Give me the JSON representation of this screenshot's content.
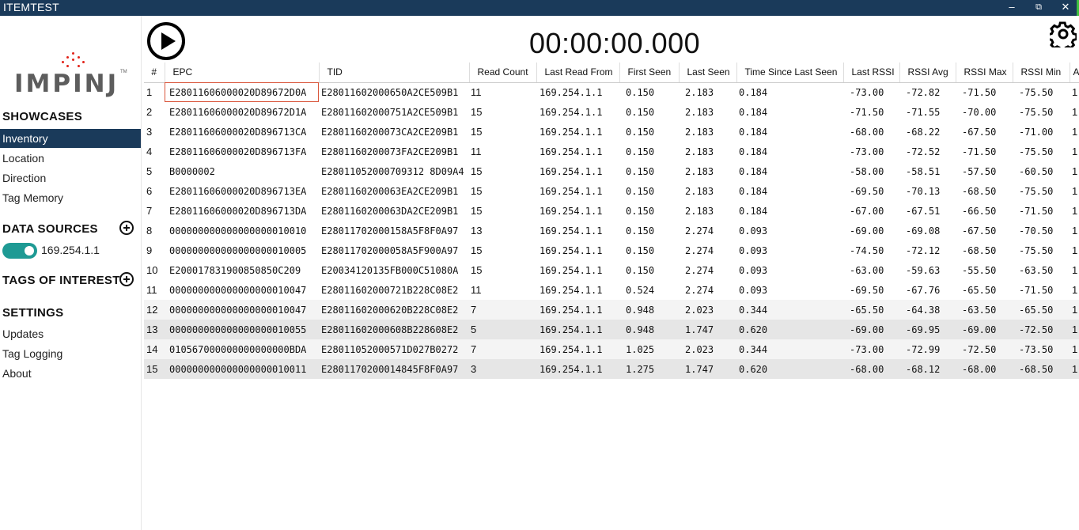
{
  "window": {
    "title": "ITEMTEST",
    "minimize": "–",
    "restore": "⧉",
    "close": "✕"
  },
  "sidebar": {
    "logo_text": "IMPINJ",
    "logo_tm": "TM",
    "showcases_title": "SHOWCASES",
    "showcases": [
      {
        "label": "Inventory",
        "active": true
      },
      {
        "label": "Location",
        "active": false
      },
      {
        "label": "Direction",
        "active": false
      },
      {
        "label": "Tag Memory",
        "active": false
      }
    ],
    "data_sources_title": "DATA SOURCES",
    "data_source": {
      "label": "169.254.1.1",
      "enabled": true
    },
    "tags_of_interest_title": "TAGS OF INTEREST",
    "settings_title": "SETTINGS",
    "settings": [
      {
        "label": "Updates"
      },
      {
        "label": "Tag Logging"
      },
      {
        "label": "About"
      }
    ]
  },
  "toolbar": {
    "timer": "00:00:00.000",
    "play_icon": "play-icon",
    "settings_icon": "gear-icon"
  },
  "table": {
    "columns": [
      "#",
      "EPC",
      "TID",
      "Read Count",
      "Last Read From",
      "First Seen",
      "Last Seen",
      "Time Since Last Seen",
      "Last RSSI",
      "RSSI Avg",
      "RSSI Max",
      "RSSI Min",
      "A"
    ],
    "rows": [
      {
        "n": "1",
        "epc": "E28011606000020D89672D0A",
        "tid": "E28011602000650A2CE509B1",
        "rc": "11",
        "from": "169.254.1.1",
        "first": "0.150",
        "last": "2.183",
        "since": "0.184",
        "lrssi": "-73.00",
        "avg": "-72.82",
        "max": "-71.50",
        "min": "-75.50",
        "extra": "1"
      },
      {
        "n": "2",
        "epc": "E28011606000020D89672D1A",
        "tid": "E28011602000751A2CE509B1",
        "rc": "15",
        "from": "169.254.1.1",
        "first": "0.150",
        "last": "2.183",
        "since": "0.184",
        "lrssi": "-71.50",
        "avg": "-71.55",
        "max": "-70.00",
        "min": "-75.50",
        "extra": "1"
      },
      {
        "n": "3",
        "epc": "E28011606000020D896713CA",
        "tid": "E2801160200073CA2CE209B1",
        "rc": "15",
        "from": "169.254.1.1",
        "first": "0.150",
        "last": "2.183",
        "since": "0.184",
        "lrssi": "-68.00",
        "avg": "-68.22",
        "max": "-67.50",
        "min": "-71.00",
        "extra": "1"
      },
      {
        "n": "4",
        "epc": "E28011606000020D896713FA",
        "tid": "E2801160200073FA2CE209B1",
        "rc": "11",
        "from": "169.254.1.1",
        "first": "0.150",
        "last": "2.183",
        "since": "0.184",
        "lrssi": "-73.00",
        "avg": "-72.52",
        "max": "-71.50",
        "min": "-75.50",
        "extra": "1"
      },
      {
        "n": "5",
        "epc": "B0000002",
        "tid": "E28011052000709312 8D09A4",
        "rc": "15",
        "from": "169.254.1.1",
        "first": "0.150",
        "last": "2.183",
        "since": "0.184",
        "lrssi": "-58.00",
        "avg": "-58.51",
        "max": "-57.50",
        "min": "-60.50",
        "extra": "1"
      },
      {
        "n": "6",
        "epc": "E28011606000020D896713EA",
        "tid": "E2801160200063EA2CE209B1",
        "rc": "15",
        "from": "169.254.1.1",
        "first": "0.150",
        "last": "2.183",
        "since": "0.184",
        "lrssi": "-69.50",
        "avg": "-70.13",
        "max": "-68.50",
        "min": "-75.50",
        "extra": "1"
      },
      {
        "n": "7",
        "epc": "E28011606000020D896713DA",
        "tid": "E2801160200063DA2CE209B1",
        "rc": "15",
        "from": "169.254.1.1",
        "first": "0.150",
        "last": "2.183",
        "since": "0.184",
        "lrssi": "-67.00",
        "avg": "-67.51",
        "max": "-66.50",
        "min": "-71.50",
        "extra": "1"
      },
      {
        "n": "8",
        "epc": "000000000000000000010010",
        "tid": "E28011702000158A5F8F0A97",
        "rc": "13",
        "from": "169.254.1.1",
        "first": "0.150",
        "last": "2.274",
        "since": "0.093",
        "lrssi": "-69.00",
        "avg": "-69.08",
        "max": "-67.50",
        "min": "-70.50",
        "extra": "1"
      },
      {
        "n": "9",
        "epc": "000000000000000000010005",
        "tid": "E28011702000058A5F900A97",
        "rc": "15",
        "from": "169.254.1.1",
        "first": "0.150",
        "last": "2.274",
        "since": "0.093",
        "lrssi": "-74.50",
        "avg": "-72.12",
        "max": "-68.50",
        "min": "-75.50",
        "extra": "1"
      },
      {
        "n": "10",
        "epc": "E200017831900850850C209",
        "tid": "E20034120135FB000C51080A",
        "rc": "15",
        "from": "169.254.1.1",
        "first": "0.150",
        "last": "2.274",
        "since": "0.093",
        "lrssi": "-63.00",
        "avg": "-59.63",
        "max": "-55.50",
        "min": "-63.50",
        "extra": "1"
      },
      {
        "n": "11",
        "epc": "000000000000000000010047",
        "tid": "E28011602000721B228C08E2",
        "rc": "11",
        "from": "169.254.1.1",
        "first": "0.524",
        "last": "2.274",
        "since": "0.093",
        "lrssi": "-69.50",
        "avg": "-67.76",
        "max": "-65.50",
        "min": "-71.50",
        "extra": "1"
      },
      {
        "n": "12",
        "epc": "000000000000000000010047",
        "tid": "E28011602000620B228C08E2",
        "rc": "7",
        "from": "169.254.1.1",
        "first": "0.948",
        "last": "2.023",
        "since": "0.344",
        "lrssi": "-65.50",
        "avg": "-64.38",
        "max": "-63.50",
        "min": "-65.50",
        "extra": "1"
      },
      {
        "n": "13",
        "epc": "000000000000000000010055",
        "tid": "E28011602000608B228608E2",
        "rc": "5",
        "from": "169.254.1.1",
        "first": "0.948",
        "last": "1.747",
        "since": "0.620",
        "lrssi": "-69.00",
        "avg": "-69.95",
        "max": "-69.00",
        "min": "-72.50",
        "extra": "1"
      },
      {
        "n": "14",
        "epc": "010567000000000000000BDA",
        "tid": "E28011052000571D027B0272",
        "rc": "7",
        "from": "169.254.1.1",
        "first": "1.025",
        "last": "2.023",
        "since": "0.344",
        "lrssi": "-73.00",
        "avg": "-72.99",
        "max": "-72.50",
        "min": "-73.50",
        "extra": "1"
      },
      {
        "n": "15",
        "epc": "000000000000000000010011",
        "tid": "E2801170200014845F8F0A97",
        "rc": "3",
        "from": "169.254.1.1",
        "first": "1.275",
        "last": "1.747",
        "since": "0.620",
        "lrssi": "-68.00",
        "avg": "-68.12",
        "max": "-68.00",
        "min": "-68.50",
        "extra": "1"
      }
    ]
  }
}
